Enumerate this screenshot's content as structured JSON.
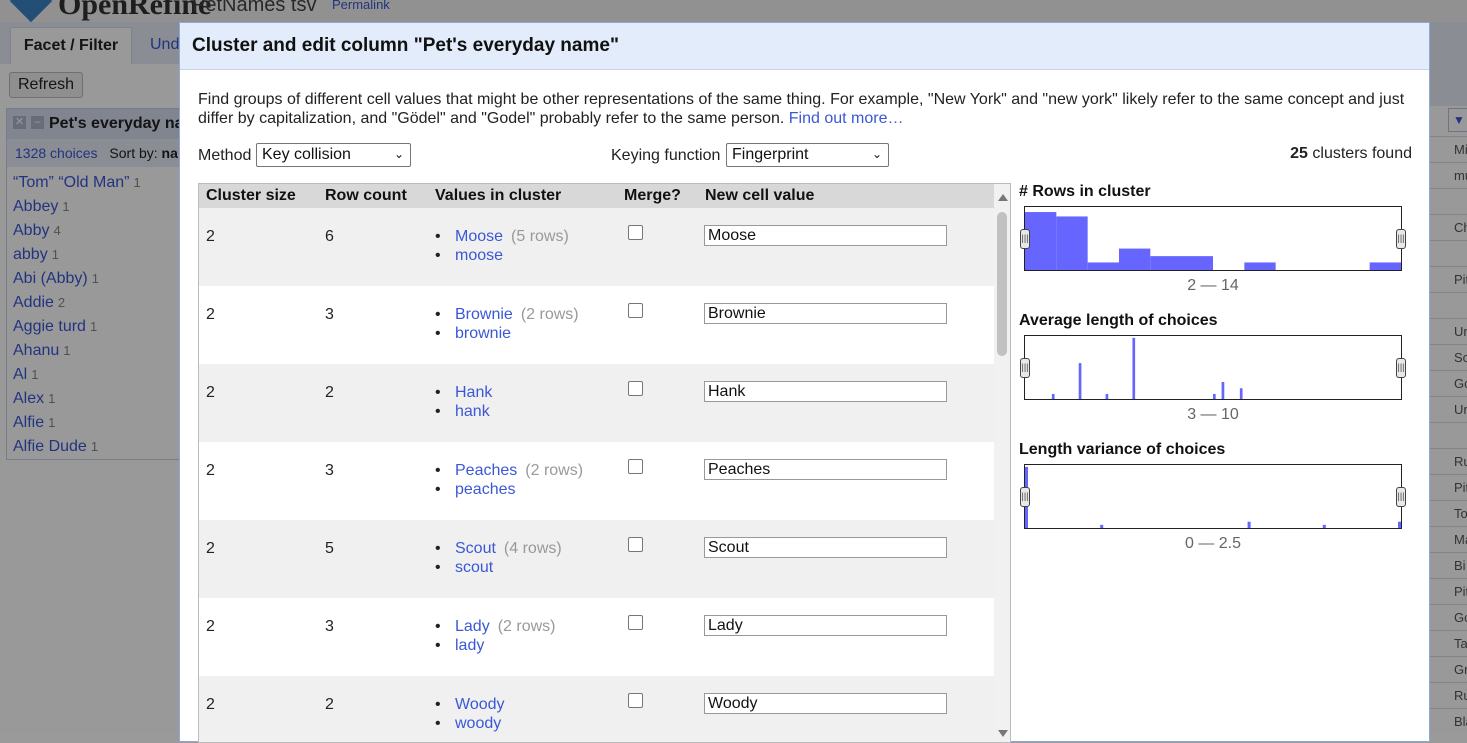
{
  "background": {
    "app_name": "OpenRefine",
    "project_name": "PetNames tsv",
    "permalink": "Permalink",
    "tabs": [
      "Facet / Filter",
      "Und"
    ],
    "refresh_label": "Refresh",
    "facet": {
      "title": "Pet's everyday na",
      "choices_count": "1328 choices",
      "sort_by": "Sort by:",
      "sort_value": "na",
      "items": [
        {
          "name": "“Tom” “Old Man”",
          "count": "1"
        },
        {
          "name": "Abbey",
          "count": "1"
        },
        {
          "name": "Abby",
          "count": "4"
        },
        {
          "name": "abby",
          "count": "1"
        },
        {
          "name": "Abi (Abby)",
          "count": "1"
        },
        {
          "name": "Addie",
          "count": "2"
        },
        {
          "name": "Aggie turd",
          "count": "1"
        },
        {
          "name": "Ahanu",
          "count": "1"
        },
        {
          "name": "Al",
          "count": "1"
        },
        {
          "name": "Alex",
          "count": "1"
        },
        {
          "name": "Alfie",
          "count": "1"
        },
        {
          "name": "Alfie Dude",
          "count": "1"
        }
      ]
    },
    "grid_cells": [
      "Mi",
      "mu",
      "",
      "Ch",
      "",
      "Pit",
      "",
      "Ur",
      "Sc",
      "Go",
      "Ur",
      "",
      "Ru",
      "Pit",
      "To",
      "Ma",
      "Bi",
      "Pit",
      "Go",
      "Ta",
      "Gr",
      "Ru",
      "Bla"
    ],
    "grid_dropdown": "▼"
  },
  "dialog": {
    "title": "Cluster and edit column \"Pet's everyday name\"",
    "description": "Find groups of different cell values that might be other representations of the same thing. For example, \"New York\" and \"new york\" likely refer to the same concept and just differ by capitalization, and \"Gödel\" and \"Godel\" probably refer to the same person.",
    "find_out_more": "Find out more…",
    "method_label": "Method",
    "method_value": "Key collision",
    "keying_label": "Keying function",
    "keying_value": "Fingerprint",
    "clusters_found_count": "25",
    "clusters_found_text": "clusters found",
    "columns": {
      "cluster_size": "Cluster size",
      "row_count": "Row count",
      "values": "Values in cluster",
      "merge": "Merge?",
      "new_value": "New cell value"
    },
    "clusters": [
      {
        "size": "2",
        "rows": "6",
        "values": [
          {
            "name": "Moose",
            "count": "(5 rows)"
          },
          {
            "name": "moose",
            "count": ""
          }
        ],
        "merge": false,
        "new_value": "Moose"
      },
      {
        "size": "2",
        "rows": "3",
        "values": [
          {
            "name": "Brownie",
            "count": "(2 rows)"
          },
          {
            "name": "brownie",
            "count": ""
          }
        ],
        "merge": false,
        "new_value": "Brownie"
      },
      {
        "size": "2",
        "rows": "2",
        "values": [
          {
            "name": "Hank",
            "count": ""
          },
          {
            "name": "hank",
            "count": ""
          }
        ],
        "merge": false,
        "new_value": "Hank"
      },
      {
        "size": "2",
        "rows": "3",
        "values": [
          {
            "name": "Peaches",
            "count": "(2 rows)"
          },
          {
            "name": "peaches",
            "count": ""
          }
        ],
        "merge": false,
        "new_value": "Peaches"
      },
      {
        "size": "2",
        "rows": "5",
        "values": [
          {
            "name": "Scout",
            "count": "(4 rows)"
          },
          {
            "name": "scout",
            "count": ""
          }
        ],
        "merge": false,
        "new_value": "Scout"
      },
      {
        "size": "2",
        "rows": "3",
        "values": [
          {
            "name": "Lady",
            "count": "(2 rows)"
          },
          {
            "name": "lady",
            "count": ""
          }
        ],
        "merge": false,
        "new_value": "Lady"
      },
      {
        "size": "2",
        "rows": "2",
        "values": [
          {
            "name": "Woody",
            "count": ""
          },
          {
            "name": "woody",
            "count": ""
          }
        ],
        "merge": false,
        "new_value": "Woody"
      }
    ],
    "histograms": [
      {
        "title": "# Rows in cluster",
        "range": "2 — 14",
        "min": 2,
        "max": 14,
        "bar_color": "#6666ff",
        "bars": [
          {
            "from": 2,
            "to": 3,
            "frac": 0.92
          },
          {
            "from": 3,
            "to": 4,
            "frac": 0.85
          },
          {
            "from": 4,
            "to": 5,
            "frac": 0.12
          },
          {
            "from": 5,
            "to": 6,
            "frac": 0.34
          },
          {
            "from": 6,
            "to": 8,
            "frac": 0.22
          },
          {
            "from": 9,
            "to": 10,
            "frac": 0.12
          },
          {
            "from": 13,
            "to": 14,
            "frac": 0.12
          }
        ]
      },
      {
        "title": "Average length of choices",
        "range": "3 — 10",
        "min": 3,
        "max": 10,
        "bar_color": "#6666ff",
        "bars": [
          {
            "from": 3.5,
            "to": 3.55,
            "frac": 0.08
          },
          {
            "from": 4,
            "to": 4.05,
            "frac": 0.57
          },
          {
            "from": 4.5,
            "to": 4.55,
            "frac": 0.08
          },
          {
            "from": 5,
            "to": 5.05,
            "frac": 0.97
          },
          {
            "from": 6.5,
            "to": 6.55,
            "frac": 0.08
          },
          {
            "from": 6.5,
            "to": 6.53,
            "frac": 0.0
          },
          {
            "from": 6.66,
            "to": 6.71,
            "frac": 0.27
          },
          {
            "from": 7.0,
            "to": 7.05,
            "frac": 0.17
          }
        ]
      },
      {
        "title": "Length variance of choices",
        "range": "0 — 2.5",
        "min": 0,
        "max": 2.5,
        "bar_color": "#6666ff",
        "bars": [
          {
            "from": 0,
            "to": 0.02,
            "frac": 0.97
          },
          {
            "from": 0.5,
            "to": 0.52,
            "frac": 0.05
          },
          {
            "from": 1.48,
            "to": 1.5,
            "frac": 0.1
          },
          {
            "from": 1.98,
            "to": 2.0,
            "frac": 0.05
          },
          {
            "from": 2.48,
            "to": 2.5,
            "frac": 0.1
          }
        ]
      }
    ]
  }
}
